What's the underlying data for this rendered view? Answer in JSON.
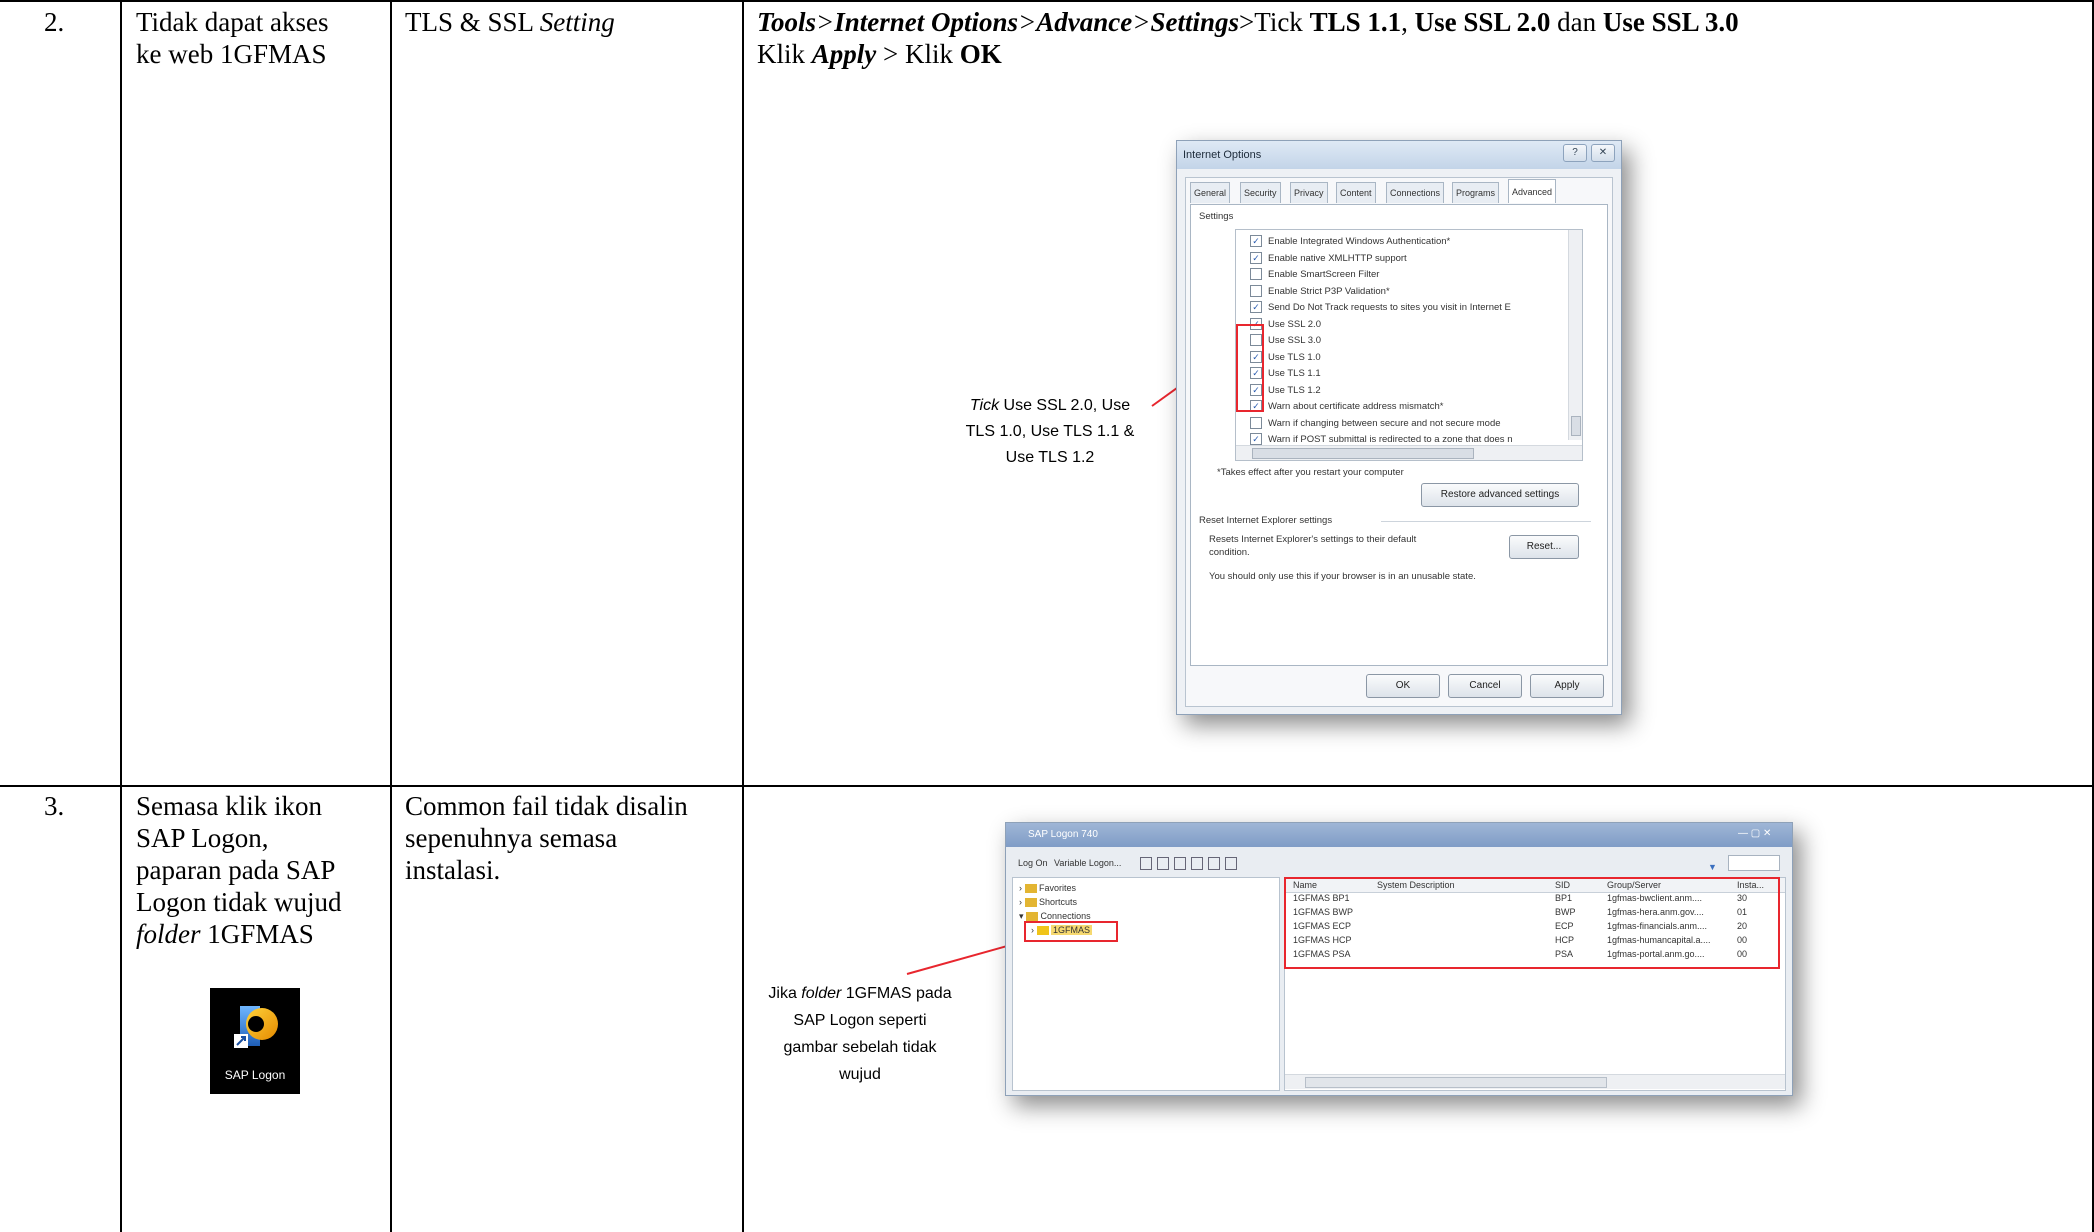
{
  "rows": [
    {
      "number": "2.",
      "issue_line1": "Tidak dapat akses",
      "issue_line2": "ke web 1GFMAS",
      "cause_plain": "TLS & SSL ",
      "cause_italic": "Setting",
      "solution": {
        "line1": {
          "p1": "Tools",
          "p2": ">",
          "p3": "Internet Options",
          "p4": ">",
          "p5": "Advance",
          "p6": ">",
          "p7": "Settings",
          "p8": ">Tick ",
          "p9": "TLS 1.1",
          "p10": ", ",
          "p11": "Use SSL 2.0",
          "p12": " dan ",
          "p13": "Use SSL 3.0"
        },
        "line2": {
          "p1": "Klik ",
          "p2": "Apply",
          "p3": " > Klik ",
          "p4": "OK"
        }
      },
      "callout": {
        "italic": "Tick",
        "line1": " Use SSL 2.0, Use",
        "line2": "TLS 1.0, Use TLS 1.1 &",
        "line3": "Use TLS 1.2"
      }
    },
    {
      "number": "3.",
      "issue_line1": "Semasa klik ikon",
      "issue_line2": "SAP Logon,",
      "issue_line3": "paparan pada SAP",
      "issue_line4": "Logon tidak wujud",
      "issue_italic": "folder",
      "issue_line5_rest": " 1GFMAS",
      "cause_line1": "Common fail tidak disalin",
      "cause_line2": "sepenuhnya semasa",
      "cause_line3": "instalasi.",
      "desktop_icon_label": "SAP Logon",
      "callout": {
        "pre": "Jika ",
        "italic": "folder",
        "line1_rest": " 1GFMAS pada",
        "line2": "SAP Logon seperti",
        "line3": "gambar sebelah tidak",
        "line4": "wujud"
      }
    }
  ],
  "internet_options": {
    "title": "Internet Options",
    "help_glyph": "?",
    "close_glyph": "✕",
    "tabs": [
      "General",
      "Security",
      "Privacy",
      "Content",
      "Connections",
      "Programs",
      "Advanced"
    ],
    "settings_label": "Settings",
    "options": [
      {
        "label": "Enable Integrated Windows Authentication*",
        "checked": true
      },
      {
        "label": "Enable native XMLHTTP support",
        "checked": true
      },
      {
        "label": "Enable SmartScreen Filter",
        "checked": false
      },
      {
        "label": "Enable Strict P3P Validation*",
        "checked": false
      },
      {
        "label": "Send Do Not Track requests to sites you visit in Internet E",
        "checked": true
      },
      {
        "label": "Use SSL 2.0",
        "checked": true
      },
      {
        "label": "Use SSL 3.0",
        "checked": false
      },
      {
        "label": "Use TLS 1.0",
        "checked": true
      },
      {
        "label": "Use TLS 1.1",
        "checked": true
      },
      {
        "label": "Use TLS 1.2",
        "checked": true
      },
      {
        "label": "Warn about certificate address mismatch*",
        "checked": true
      },
      {
        "label": "Warn if changing between secure and not secure mode",
        "checked": false
      },
      {
        "label": "Warn if POST submittal is redirected to a zone that does n",
        "checked": true
      }
    ],
    "restart_note": "*Takes effect after you restart your computer",
    "restore_button": "Restore advanced settings",
    "reset_group_label": "Reset Internet Explorer settings",
    "reset_desc_line1": "Resets Internet Explorer's settings to their default",
    "reset_desc_line2": "condition.",
    "reset_button": "Reset...",
    "warning": "You should only use this if your browser is in an unusable state.",
    "ok_button": "OK",
    "cancel_button": "Cancel",
    "apply_button": "Apply"
  },
  "sap_logon": {
    "title": "SAP Logon 740",
    "toolbar_logon": "Log On",
    "toolbar_variable": "Variable Logon...",
    "tree": [
      "Favorites",
      "Shortcuts",
      "Connections",
      "1GFMAS"
    ],
    "columns": [
      "Name",
      "System Description",
      "SID",
      "Group/Server",
      "Insta..."
    ],
    "entries": [
      [
        "1GFMAS BP1",
        "",
        "BP1",
        "1gfmas-bwclient.anm....",
        "30"
      ],
      [
        "1GFMAS BWP",
        "",
        "BWP",
        "1gfmas-hera.anm.gov....",
        "01"
      ],
      [
        "1GFMAS ECP",
        "",
        "ECP",
        "1gfmas-financials.anm....",
        "20"
      ],
      [
        "1GFMAS HCP",
        "",
        "HCP",
        "1gfmas-humancapital.a....",
        "00"
      ],
      [
        "1GFMAS PSA",
        "",
        "PSA",
        "1gfmas-portal.anm.go....",
        "00"
      ]
    ]
  },
  "colors": {
    "red": "#e8262e",
    "folder": "#e3b532",
    "selected_folder": "#f0c419"
  }
}
